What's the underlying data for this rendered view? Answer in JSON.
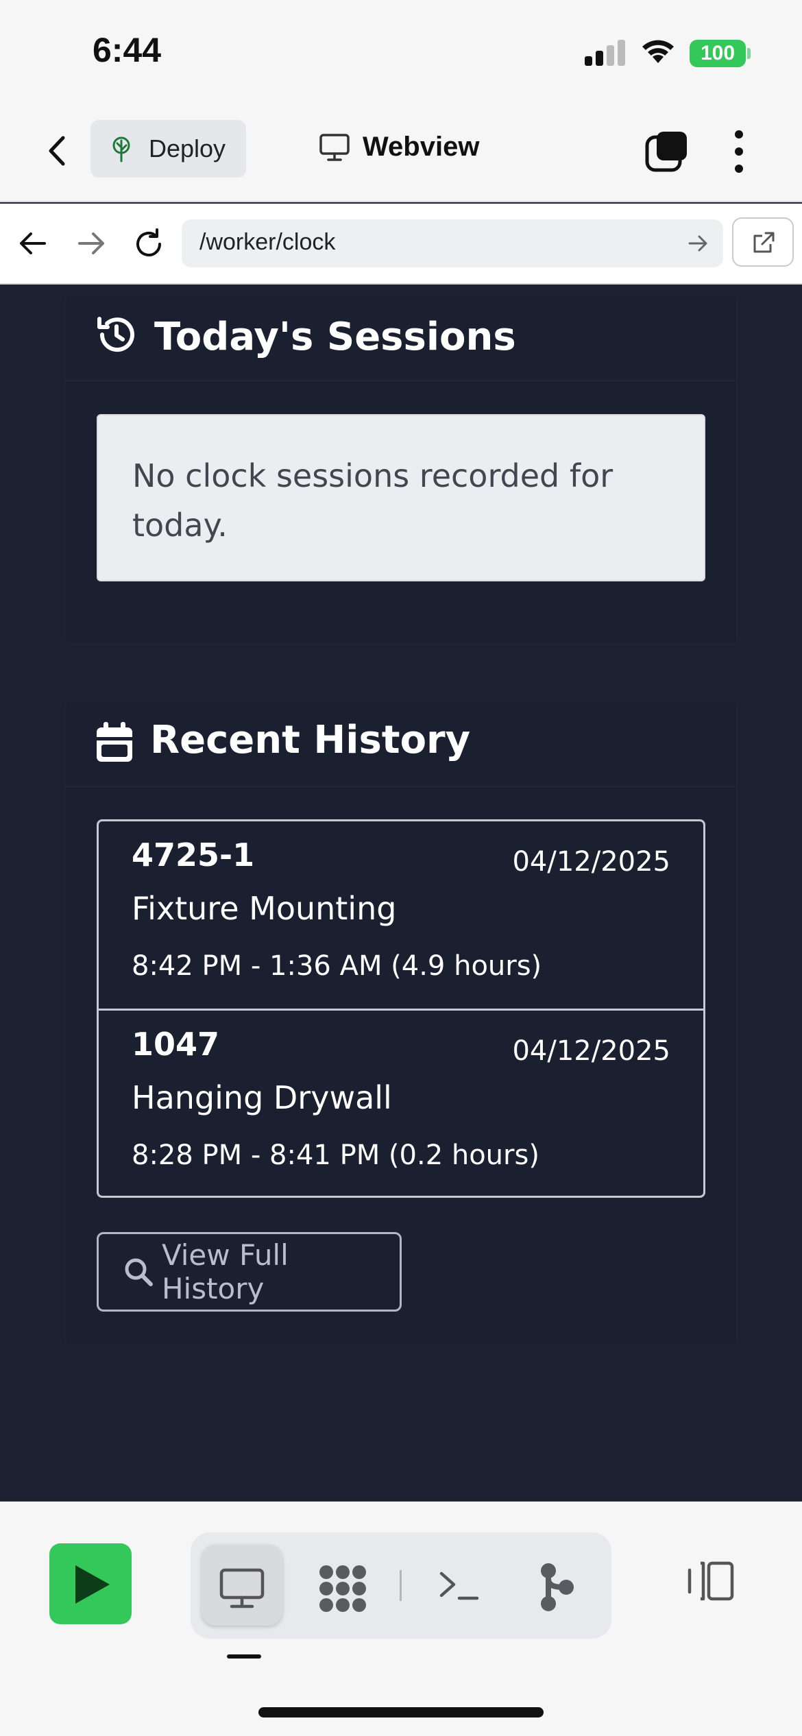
{
  "status_bar": {
    "time": "6:44",
    "battery": "100"
  },
  "header": {
    "project_label": "Deploy",
    "view_label": "Webview"
  },
  "url_bar": {
    "url": "/worker/clock"
  },
  "sessions": {
    "title": "Today's Sessions",
    "empty_message": "No clock sessions recorded for today."
  },
  "history": {
    "title": "Recent History",
    "entries": [
      {
        "code": "4725-1",
        "date": "04/12/2025",
        "task": "Fixture Mounting",
        "times": "8:42 PM - 1:36 AM (4.9 hours)"
      },
      {
        "code": "1047",
        "date": "04/12/2025",
        "task": "Hanging Drywall",
        "times": "8:28 PM - 8:41 PM (0.2 hours)"
      }
    ],
    "button_label": "View Full History"
  },
  "colors": {
    "page_bg": "#1d2233",
    "run_green": "#34c759",
    "battery_green": "#34c759"
  },
  "icons": {
    "status": [
      "cellular-signal-icon",
      "wifi-icon",
      "battery-icon"
    ],
    "header": [
      "back-chevron-icon",
      "deploy-tree-icon",
      "monitor-icon",
      "tabs-icon",
      "more-vertical-icon"
    ],
    "url_bar": [
      "arrow-left-icon",
      "arrow-right-icon",
      "reload-icon",
      "go-arrow-icon",
      "open-external-icon"
    ],
    "content": [
      "history-clock-icon",
      "calendar-icon",
      "search-icon"
    ],
    "toolbar": [
      "play-icon",
      "monitor-icon",
      "grid-dots-icon",
      "terminal-icon",
      "branch-icon",
      "split-view-icon"
    ]
  }
}
